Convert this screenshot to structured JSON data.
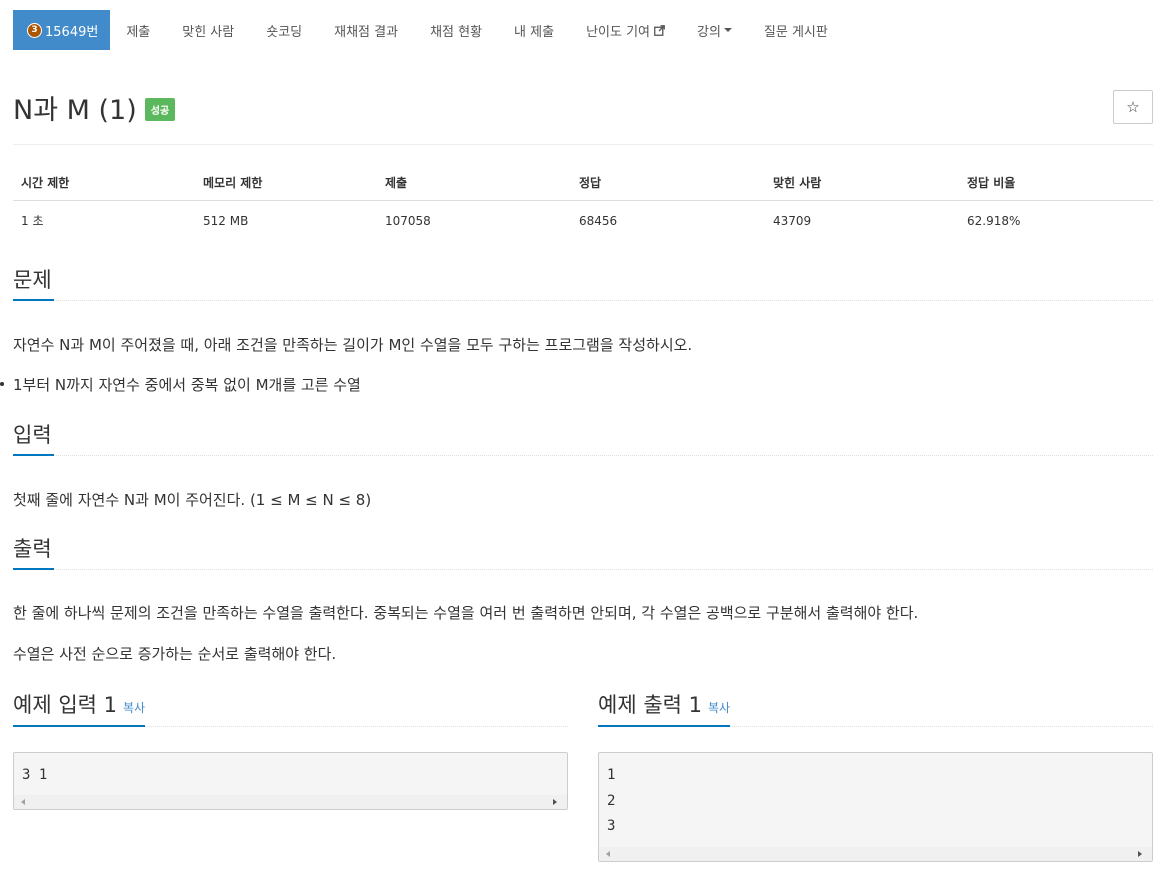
{
  "nav": {
    "tier_badge": "3",
    "problem_number": "15649번",
    "items": [
      "제출",
      "맞힌 사람",
      "숏코딩",
      "재채점 결과",
      "채점 현황",
      "내 제출",
      "난이도 기여",
      "강의",
      "질문 게시판"
    ]
  },
  "problem": {
    "title": "N과 M (1)",
    "result_badge": "성공",
    "star_icon": "☆"
  },
  "info_table": {
    "headers": [
      "시간 제한",
      "메모리 제한",
      "제출",
      "정답",
      "맞힌 사람",
      "정답 비율"
    ],
    "row": [
      "1 초",
      "512 MB",
      "107058",
      "68456",
      "43709",
      "62.918%"
    ]
  },
  "sections": {
    "description": {
      "heading": "문제",
      "text": "자연수 N과 M이 주어졌을 때, 아래 조건을 만족하는 길이가 M인 수열을 모두 구하는 프로그램을 작성하시오.",
      "conditions": [
        "1부터 N까지 자연수 중에서 중복 없이 M개를 고른 수열"
      ]
    },
    "input": {
      "heading": "입력",
      "text": "첫째 줄에 자연수 N과 M이 주어진다. (1 ≤ M ≤ N ≤ 8)"
    },
    "output": {
      "heading": "출력",
      "lines": [
        "한 줄에 하나씩 문제의 조건을 만족하는 수열을 출력한다. 중복되는 수열을 여러 번 출력하면 안되며, 각 수열은 공백으로 구분해서 출력해야 한다.",
        "수열은 사전 순으로 증가하는 순서로 출력해야 한다."
      ]
    }
  },
  "samples": {
    "input": {
      "heading": "예제 입력 1",
      "copy_label": "복사",
      "content": "3 1"
    },
    "output": {
      "heading": "예제 출력 1",
      "copy_label": "복사",
      "content": "1\n2\n3"
    }
  },
  "colors": {
    "nav_active": "#428bca",
    "success_badge": "#5cb85c",
    "section_underline": "#0076c0",
    "link": "#428bca",
    "tier_badge": "#ad5600"
  }
}
